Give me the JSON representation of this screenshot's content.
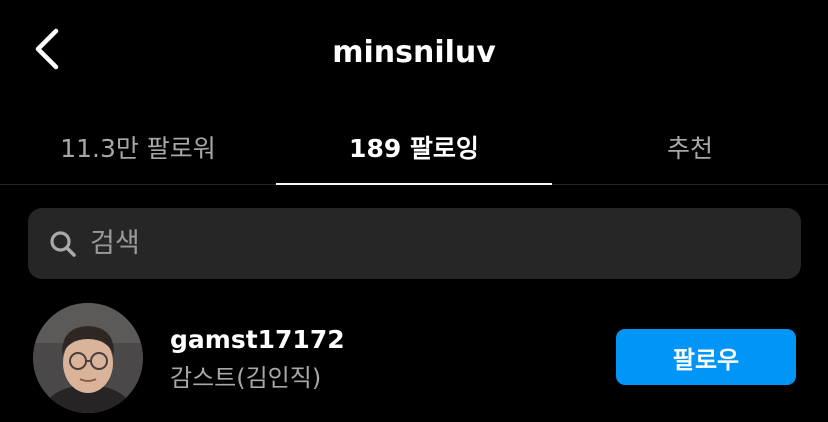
{
  "header": {
    "title": "minsniluv",
    "back_icon": "chevron-left-icon"
  },
  "tabs": [
    {
      "label": "11.3만 팔로워",
      "active": false
    },
    {
      "label": "189 팔로잉",
      "active": true
    },
    {
      "label": "추천",
      "active": false
    }
  ],
  "search": {
    "icon": "search-icon",
    "placeholder": "검색",
    "value": ""
  },
  "users": [
    {
      "username": "gamst17172",
      "full_name": "감스트(김인직)",
      "button_label": "팔로우"
    }
  ],
  "colors": {
    "background": "#000000",
    "accent": "#0095f6",
    "muted_text": "#a8a8a8",
    "search_bg": "#262626"
  }
}
